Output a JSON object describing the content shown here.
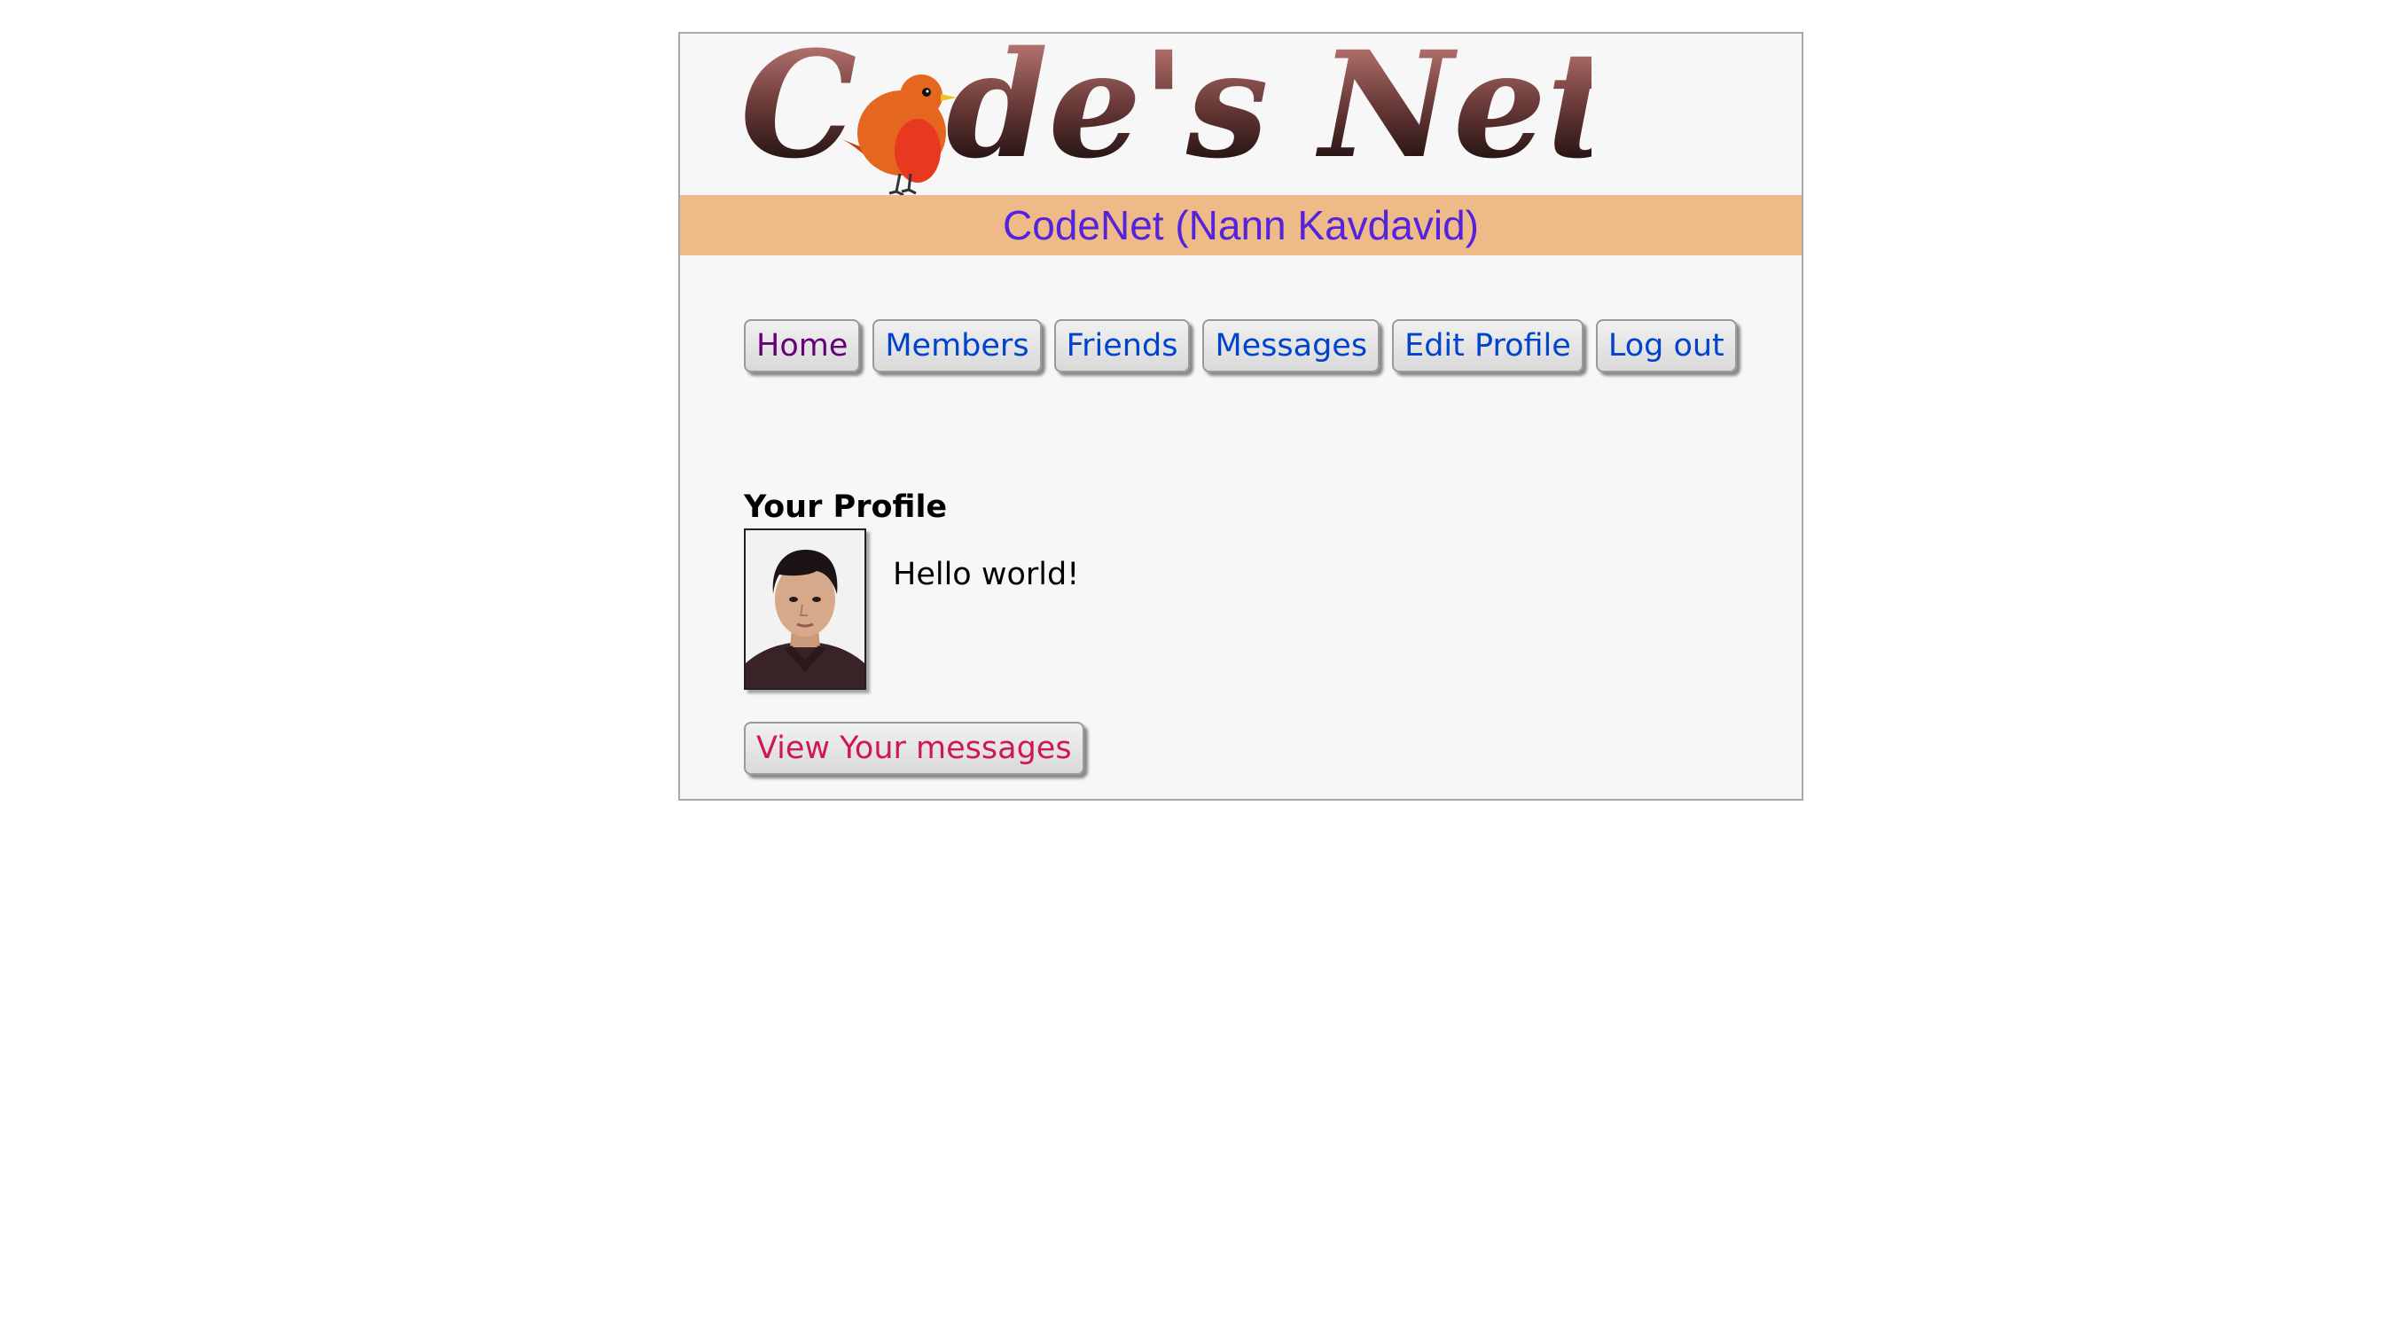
{
  "logo": {
    "text_before": "C",
    "text_after": "de's Net"
  },
  "site_title": "CodeNet (Nann Kavdavid)",
  "nav": {
    "items": [
      {
        "label": "Home",
        "visited": true
      },
      {
        "label": "Members"
      },
      {
        "label": "Friends"
      },
      {
        "label": "Messages"
      },
      {
        "label": "Edit Profile"
      },
      {
        "label": "Log out"
      }
    ]
  },
  "profile": {
    "heading": "Your Profile",
    "bio": "Hello world!",
    "view_messages_label": "View Your messages"
  },
  "colors": {
    "title_band": "#eebb88",
    "title_text": "#5522dd",
    "link": "#0044cc",
    "visited_link": "#660077",
    "message_link": "#d01850"
  }
}
